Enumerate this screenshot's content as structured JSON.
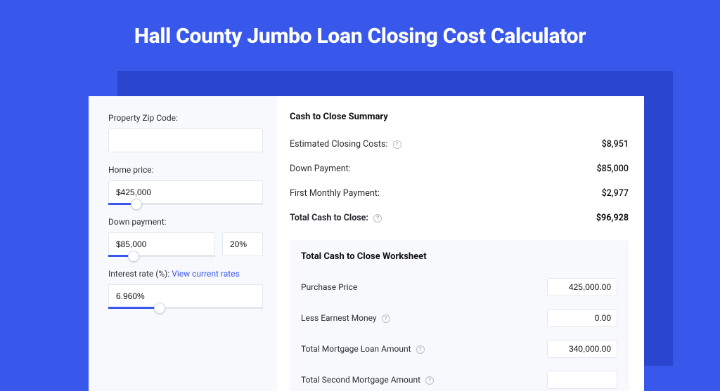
{
  "page": {
    "title": "Hall County Jumbo Loan Closing Cost Calculator"
  },
  "left": {
    "zip": {
      "label": "Property Zip Code:",
      "value": ""
    },
    "home_price": {
      "label": "Home price:",
      "value": "$425,000",
      "fill_pct": 18
    },
    "down_payment": {
      "label": "Down payment:",
      "value": "$85,000",
      "pct": "20%",
      "fill_pct": 24
    },
    "interest": {
      "label_prefix": "Interest rate (%): ",
      "link_text": "View current rates",
      "value": "6.960%",
      "fill_pct": 33
    }
  },
  "summary": {
    "heading": "Cash to Close Summary",
    "rows": [
      {
        "label": "Estimated Closing Costs:",
        "help": true,
        "value": "$8,951"
      },
      {
        "label": "Down Payment:",
        "help": false,
        "value": "$85,000"
      },
      {
        "label": "First Monthly Payment:",
        "help": false,
        "value": "$2,977"
      }
    ],
    "total": {
      "label": "Total Cash to Close:",
      "help": true,
      "value": "$96,928"
    }
  },
  "worksheet": {
    "heading": "Total Cash to Close Worksheet",
    "rows": [
      {
        "label": "Purchase Price",
        "help": false,
        "value": "425,000.00"
      },
      {
        "label": "Less Earnest Money",
        "help": true,
        "value": "0.00"
      },
      {
        "label": "Total Mortgage Loan Amount",
        "help": true,
        "value": "340,000.00"
      },
      {
        "label": "Total Second Mortgage Amount",
        "help": true,
        "value": ""
      }
    ]
  }
}
